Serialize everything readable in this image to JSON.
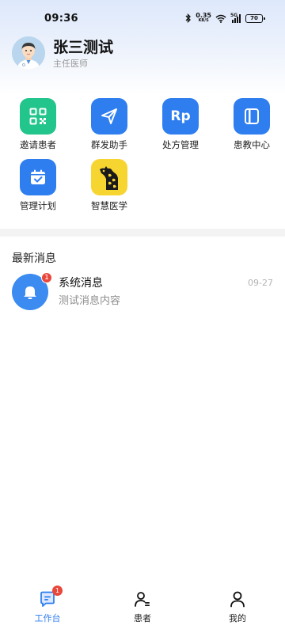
{
  "status_bar": {
    "time": "09:36",
    "network_speed": "0.35",
    "network_unit": "KB/S",
    "signal_type": "5G",
    "battery": "70"
  },
  "profile": {
    "name": "张三测试",
    "title": "主任医师"
  },
  "quick_actions": [
    {
      "label": "邀请患者",
      "icon": "qr-code-icon",
      "color": "#22c58b"
    },
    {
      "label": "群发助手",
      "icon": "send-icon",
      "color": "#2f7ef0"
    },
    {
      "label": "处方管理",
      "icon": "rp-icon",
      "icon_text": "Rp",
      "color": "#2f7ef0"
    },
    {
      "label": "患教中心",
      "icon": "book-icon",
      "color": "#2f7ef0"
    },
    {
      "label": "管理计划",
      "icon": "calendar-check-icon",
      "color": "#2f7ef0"
    },
    {
      "label": "智慧医学",
      "icon": "giraffe-logo-icon",
      "color": "#f7d531"
    }
  ],
  "messages": {
    "section_title": "最新消息",
    "items": [
      {
        "title": "系统消息",
        "preview": "测试消息内容",
        "time": "09-27",
        "badge": "1",
        "icon": "bell-icon"
      }
    ]
  },
  "bottom_nav": [
    {
      "label": "工作台",
      "icon": "workbench-chat-icon",
      "active": true,
      "badge": "1"
    },
    {
      "label": "患者",
      "icon": "patients-icon",
      "active": false
    },
    {
      "label": "我的",
      "icon": "profile-icon",
      "active": false
    }
  ],
  "colors": {
    "accent": "#2f7ef0",
    "green": "#22c58b",
    "yellow": "#f7d531",
    "badge": "#e9473a"
  }
}
